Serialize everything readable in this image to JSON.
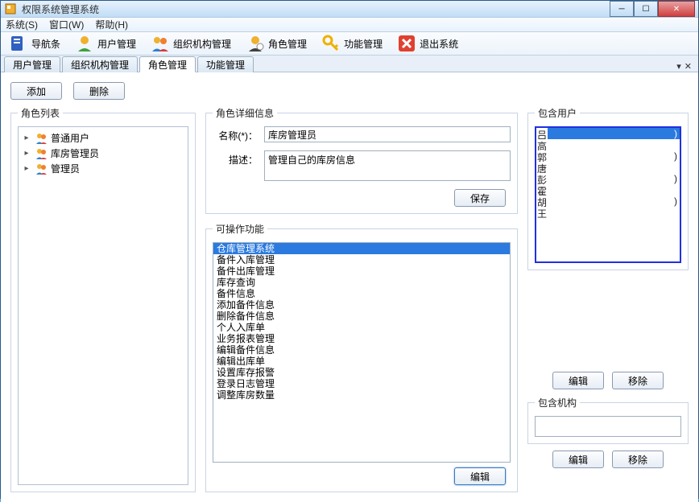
{
  "window": {
    "title": "权限系统管理系统"
  },
  "menus": {
    "system": "系统(S)",
    "window": "窗口(W)",
    "help": "帮助(H)"
  },
  "toolbar": {
    "nav": "导航条",
    "user": "用户管理",
    "org": "组织机构管理",
    "role": "角色管理",
    "func": "功能管理",
    "exit": "退出系统"
  },
  "tabs": {
    "t0": "用户管理",
    "t1": "组织机构管理",
    "t2": "角色管理",
    "t3": "功能管理"
  },
  "buttons": {
    "add": "添加",
    "delete": "删除",
    "save": "保存",
    "edit": "编辑",
    "remove": "移除"
  },
  "rolelist": {
    "legend": "角色列表",
    "items": [
      "普通用户",
      "库房管理员",
      "管理员"
    ]
  },
  "detail": {
    "legend": "角色详细信息",
    "name_label": "名称(*)：",
    "name_value": "库房管理员",
    "desc_label": "描述：",
    "desc_value": "管理自己的库房信息"
  },
  "ops": {
    "legend": "可操作功能",
    "items": [
      "仓库管理系统",
      "备件入库管理",
      "备件出库管理",
      "库存查询",
      "备件信息",
      "添加备件信息",
      "删除备件信息",
      "个人入库单",
      "业务报表管理",
      "编辑备件信息",
      "编辑出库单",
      "设置库存报警",
      "登录日志管理",
      "调整库房数量"
    ]
  },
  "users": {
    "legend": "包含用户",
    "items": [
      {
        "c1": "吕",
        "c2": "",
        "c3": ")"
      },
      {
        "c1": "高",
        "c2": "",
        "c3": ""
      },
      {
        "c1": "郭",
        "c2": "",
        "c3": ")"
      },
      {
        "c1": "唐",
        "c2": "",
        "c3": ""
      },
      {
        "c1": "彭",
        "c2": "",
        "c3": ")"
      },
      {
        "c1": "霍",
        "c2": "",
        "c3": ""
      },
      {
        "c1": "胡",
        "c2": "",
        "c3": ")"
      },
      {
        "c1": "王",
        "c2": "",
        "c3": ""
      }
    ]
  },
  "org": {
    "legend": "包含机构"
  }
}
